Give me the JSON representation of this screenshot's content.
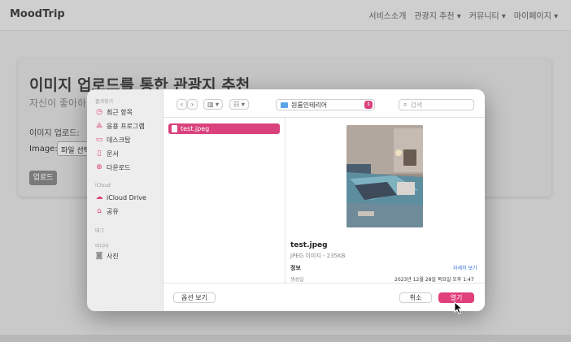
{
  "colors": {
    "accent": "#d9427d",
    "link": "#2f6ee0",
    "overlay": "#c9c9c9"
  },
  "background_page": {
    "logo": "MoodTrip",
    "nav": [
      "서비스소개",
      "관광지 추천 ▾",
      "커뮤니티 ▾",
      "마이페이지 ▾"
    ],
    "title": "이미지 업로드를 통한 관광지 추천",
    "subtitle": "자신이 좋아하",
    "upload_label": "이미지 업로드:",
    "image_label": "Image:",
    "file_button": "파일 선택",
    "submit_button": "업로드"
  },
  "dialog": {
    "sidebar": {
      "favorites_heading": "즐겨찾기",
      "favorites": [
        {
          "label": "최근 항목",
          "icon": "clock-icon"
        },
        {
          "label": "응용 프로그램",
          "icon": "applications-icon"
        },
        {
          "label": "데스크탑",
          "icon": "desktop-icon"
        },
        {
          "label": "문서",
          "icon": "document-icon"
        },
        {
          "label": "다운로드",
          "icon": "download-icon"
        }
      ],
      "icloud_heading": "iCloud",
      "icloud": [
        {
          "label": "iCloud Drive",
          "icon": "cloud-icon"
        },
        {
          "label": "공유",
          "icon": "shared-folder-icon"
        }
      ],
      "tags_heading": "태그",
      "media_heading": "미디어",
      "media": [
        {
          "label": "사진",
          "icon": "camera-icon"
        }
      ]
    },
    "toolbar": {
      "location": "원룸인테리어",
      "search_placeholder": "검색"
    },
    "file_list": [
      {
        "name": "test.jpeg",
        "selected": true
      }
    ],
    "preview": {
      "name": "test.jpeg",
      "type": "JPEG 이미지 - 235KB",
      "info_heading": "정보",
      "more_link": "자세히 보기",
      "created_label": "생성일",
      "created_value": "2023년 12월 28일 목요일 오후 1:47"
    },
    "footer": {
      "options_button": "옵션 보기",
      "cancel_button": "취소",
      "open_button": "열기"
    }
  }
}
